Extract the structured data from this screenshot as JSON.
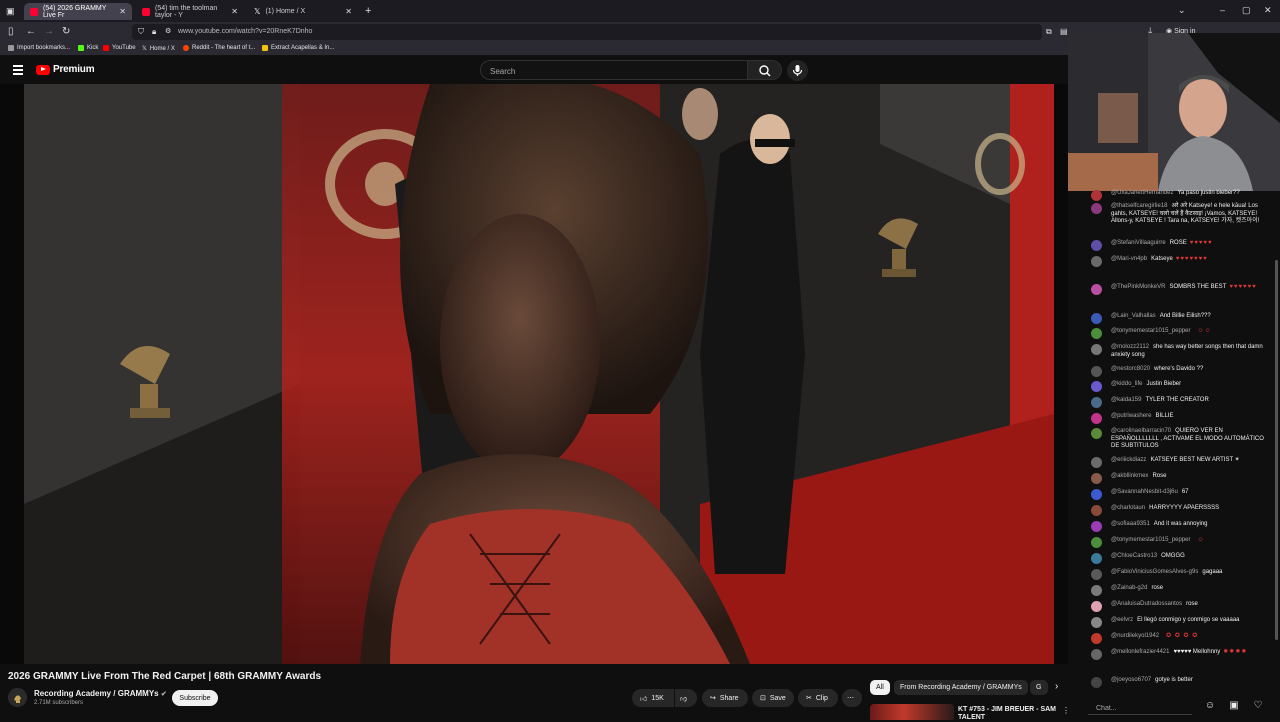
{
  "browser": {
    "tabs": [
      {
        "label": "(54) 2026 GRAMMY Live Fr",
        "active": true
      },
      {
        "label": "(54) tim the toolman taylor - Y",
        "active": false
      },
      {
        "label": "(1) Home / X",
        "active": false
      }
    ],
    "url": "www.youtube.com/watch?v=20RneK7Dnho",
    "bookmarks": [
      "Import bookmarks...",
      "Kick",
      "YouTube",
      "Home / X",
      "Reddit - The heart of t...",
      "Extract Acapellas & In..."
    ],
    "sign_in": "Sign in"
  },
  "youtube": {
    "logo_text": "Premium",
    "search_placeholder": "Search",
    "video_title": "2026 GRAMMY Live From The Red Carpet | 68th GRAMMY Awards",
    "channel_name": "Recording Academy / GRAMMYs",
    "channel_subs": "2.71M subscribers",
    "subscribe_label": "Subscribe",
    "likes": "15K",
    "share_label": "Share",
    "save_label": "Save",
    "clip_label": "Clip",
    "chips": [
      "All",
      "From Recording Academy / GRAMMYs",
      "G"
    ],
    "recommended_title": "KT #753 - JIM BREUER - SAM TALENT"
  },
  "chat": {
    "input_placeholder": "Chat...",
    "messages": [
      {
        "author": "@UxaJanettHernandez",
        "text": "Ya paso justin bieber??",
        "color": "#b0333a"
      },
      {
        "author": "@thatselfcaregirlie18",
        "text": "अरे अरे Katseye! e hele kāua! Los gahts, KATSEYE! चलो चलें हैं कैटसाइ! ¡Vamos, KATSEYE! Allons-y, KATSEYE ! Tara na, KATSEYE! 가자, 켓즈아이!",
        "color": "#8a3a7a"
      },
      {
        "author": "@StefaniVillaaguirre",
        "text": "ROSE",
        "emoji": "♥♥♥♥♥",
        "color": "#5e4ea8"
      },
      {
        "author": "@Mari-vn4pb",
        "text": "Katseye",
        "emoji": "♥♥♥♥♥♥♥",
        "color": "#6a6a6a"
      },
      {
        "author": "@ThePinkMonkeVR",
        "text": "SOMBRS THE BEST",
        "emoji": "♥♥♥♥♥♥",
        "color": "#b94fa0"
      },
      {
        "author": "@Lain_Valhallas",
        "text": "And Billie Eilish???",
        "color": "#3b5bb5"
      },
      {
        "author": "@tonymemestar1015_pepper",
        "text": "",
        "emoji": "☺☺",
        "color": "#4b8f3a"
      },
      {
        "author": "@molozz2112",
        "text": "she has way better songs then that damn anxiety song",
        "color": "#777"
      },
      {
        "author": "@nestorc8020",
        "text": "where's Davido ??",
        "color": "#555"
      },
      {
        "author": "@kiddo_life",
        "text": "Justin Bieber",
        "color": "#6a5acd"
      },
      {
        "author": "@kaida159",
        "text": "TYLER THE CREATOR",
        "color": "#4a6a8a"
      },
      {
        "author": "@putriwashere",
        "text": "BILLIE",
        "color": "#c2338a"
      },
      {
        "author": "@carolinaelbarracin70",
        "text": "QUIERO VER EN ESPAÑOLLLLLLL , ACTIVAME EL MODO AUTOMÁTICO DE SUBTITULOS",
        "color": "#5a8a3a"
      },
      {
        "author": "@eriiickdiazz",
        "text": "KATSEYE BEST NEW ARTIST ✴",
        "color": "#6b6b6b"
      },
      {
        "author": "@akbllinkmex",
        "text": "Rose",
        "color": "#8a5a4a"
      },
      {
        "author": "@SavannahNesbit-d3j6u",
        "text": "67",
        "color": "#3d5bd1"
      },
      {
        "author": "@charlotaun",
        "text": "HARRYYYY APAERSSSS",
        "color": "#8a4a3a"
      },
      {
        "author": "@sofiaaa9351",
        "text": "And it was annoying",
        "color": "#9b3bb5"
      },
      {
        "author": "@tonymemestar1015_pepper",
        "text": "",
        "emoji": "☺",
        "color": "#4b8f3a"
      },
      {
        "author": "@ChloeCastro13",
        "text": "OMGGG",
        "color": "#3a7a9a"
      },
      {
        "author": "@FabioViniciusGomesAlves-g9s",
        "text": "gagaaa",
        "color": "#5a5a5a"
      },
      {
        "author": "@Zainab-g2d",
        "text": "rose",
        "color": "#7a7a7a"
      },
      {
        "author": "@AnaluisaDutradossantos",
        "text": "rose",
        "color": "#e0a0b0"
      },
      {
        "author": "@eelvrz",
        "text": "El llegó conmigo y conmigo se vaaaaa",
        "color": "#888"
      },
      {
        "author": "@nurdilekyol1942",
        "text": "",
        "emoji": "✪ ✪ ✪ ✪",
        "color": "#c23a2a"
      },
      {
        "author": "@mellonlefrazier4421",
        "text": "♥♥♥♥♥ Mellohnny",
        "emoji": "✸✸✸✸",
        "color": "#666"
      },
      {
        "author": "@joeyoso6707",
        "text": "gotye is better",
        "color": "#444"
      }
    ]
  }
}
